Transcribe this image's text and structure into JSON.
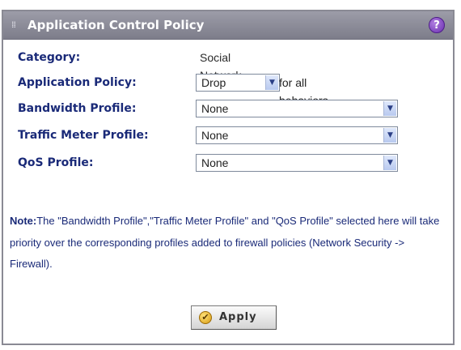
{
  "window": {
    "title": "Application Control Policy",
    "help_glyph": "?"
  },
  "form": {
    "category": {
      "label": "Category:",
      "value": "Social Network"
    },
    "application_policy": {
      "label": "Application Policy:",
      "selected": "Drop",
      "suffix": "for all behaviors"
    },
    "bandwidth_profile": {
      "label": "Bandwidth Profile:",
      "selected": "None"
    },
    "traffic_meter_profile": {
      "label": "Traffic Meter Profile:",
      "selected": "None"
    },
    "qos_profile": {
      "label": "QoS Profile:",
      "selected": "None"
    }
  },
  "note": {
    "prefix": "Note:",
    "text": "The \"Bandwidth Profile\",\"Traffic Meter Profile\" and \"QoS Profile\" selected here will take priority over the corresponding profiles added to firewall policies (Network Security -> Firewall)."
  },
  "actions": {
    "apply_label": "Apply"
  },
  "icons": {
    "grip": "grip-icon",
    "help": "help-icon",
    "dropdown": "chevron-down-icon",
    "apply": "check-circle-icon"
  },
  "colors": {
    "titlebar": "#8a8a96",
    "label": "#1a2a78",
    "help_icon": "#7b3fc4"
  }
}
